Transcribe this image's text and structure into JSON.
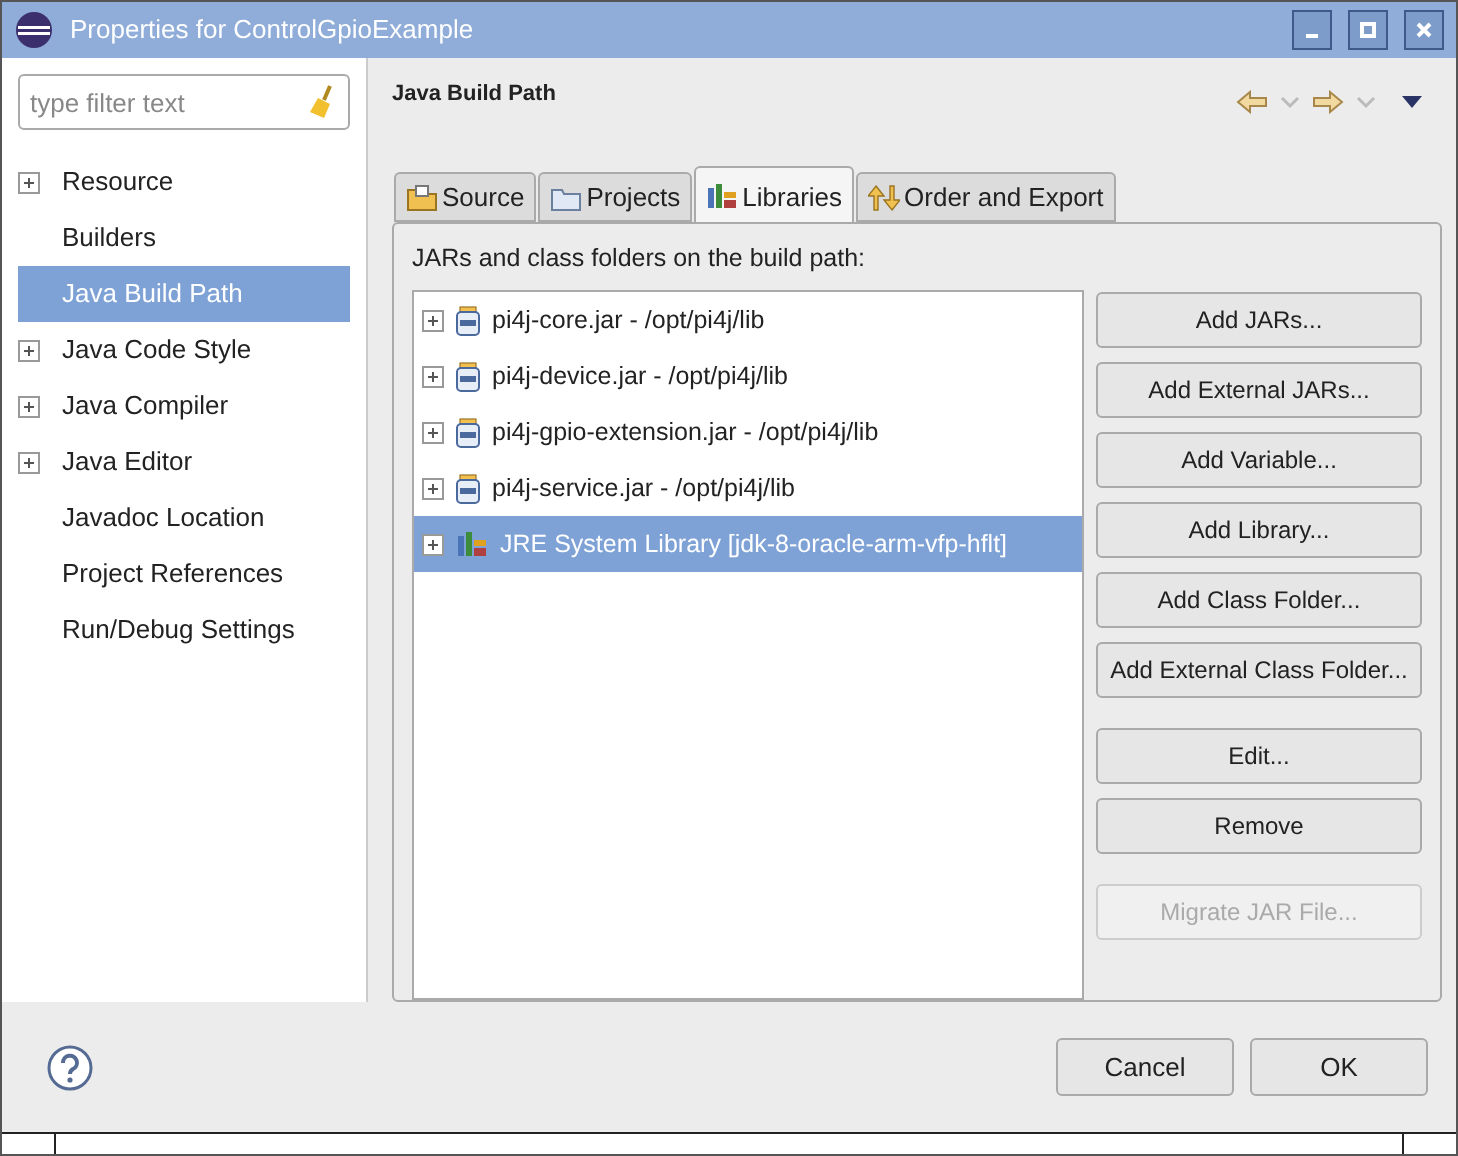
{
  "window": {
    "title": "Properties for ControlGpioExample"
  },
  "filter": {
    "placeholder": "type filter text"
  },
  "sidebar": {
    "items": [
      {
        "label": "Resource",
        "expandable": true,
        "selected": false
      },
      {
        "label": "Builders",
        "expandable": false,
        "selected": false
      },
      {
        "label": "Java Build Path",
        "expandable": false,
        "selected": true
      },
      {
        "label": "Java Code Style",
        "expandable": true,
        "selected": false
      },
      {
        "label": "Java Compiler",
        "expandable": true,
        "selected": false
      },
      {
        "label": "Java Editor",
        "expandable": true,
        "selected": false
      },
      {
        "label": "Javadoc Location",
        "expandable": false,
        "selected": false
      },
      {
        "label": "Project References",
        "expandable": false,
        "selected": false
      },
      {
        "label": "Run/Debug Settings",
        "expandable": false,
        "selected": false
      }
    ]
  },
  "page_title": "Java Build Path",
  "tabs": [
    {
      "label": "Source",
      "kind": "source",
      "selected": false
    },
    {
      "label": "Projects",
      "kind": "projects",
      "selected": false
    },
    {
      "label": "Libraries",
      "kind": "libraries",
      "selected": true
    },
    {
      "label": "Order and Export",
      "kind": "order",
      "selected": false
    }
  ],
  "list_label": "JARs and class folders on the build path:",
  "entries": [
    {
      "label": "pi4j-core.jar - /opt/pi4j/lib",
      "kind": "jar",
      "selected": false
    },
    {
      "label": "pi4j-device.jar - /opt/pi4j/lib",
      "kind": "jar",
      "selected": false
    },
    {
      "label": "pi4j-gpio-extension.jar - /opt/pi4j/lib",
      "kind": "jar",
      "selected": false
    },
    {
      "label": "pi4j-service.jar - /opt/pi4j/lib",
      "kind": "jar",
      "selected": false
    },
    {
      "label": "JRE System Library [jdk-8-oracle-arm-vfp-hflt]",
      "kind": "library",
      "selected": true
    }
  ],
  "buttons": [
    {
      "label": "Add JARs...",
      "disabled": false,
      "gap_before": false
    },
    {
      "label": "Add External JARs...",
      "disabled": false,
      "gap_before": false
    },
    {
      "label": "Add Variable...",
      "disabled": false,
      "gap_before": false
    },
    {
      "label": "Add Library...",
      "disabled": false,
      "gap_before": false
    },
    {
      "label": "Add Class Folder...",
      "disabled": false,
      "gap_before": false
    },
    {
      "label": "Add External Class Folder...",
      "disabled": false,
      "gap_before": false
    },
    {
      "label": "Edit...",
      "disabled": false,
      "gap_before": true
    },
    {
      "label": "Remove",
      "disabled": false,
      "gap_before": false
    },
    {
      "label": "Migrate JAR File...",
      "disabled": true,
      "gap_before": true
    }
  ],
  "footer_buttons": [
    "Cancel",
    "OK"
  ]
}
